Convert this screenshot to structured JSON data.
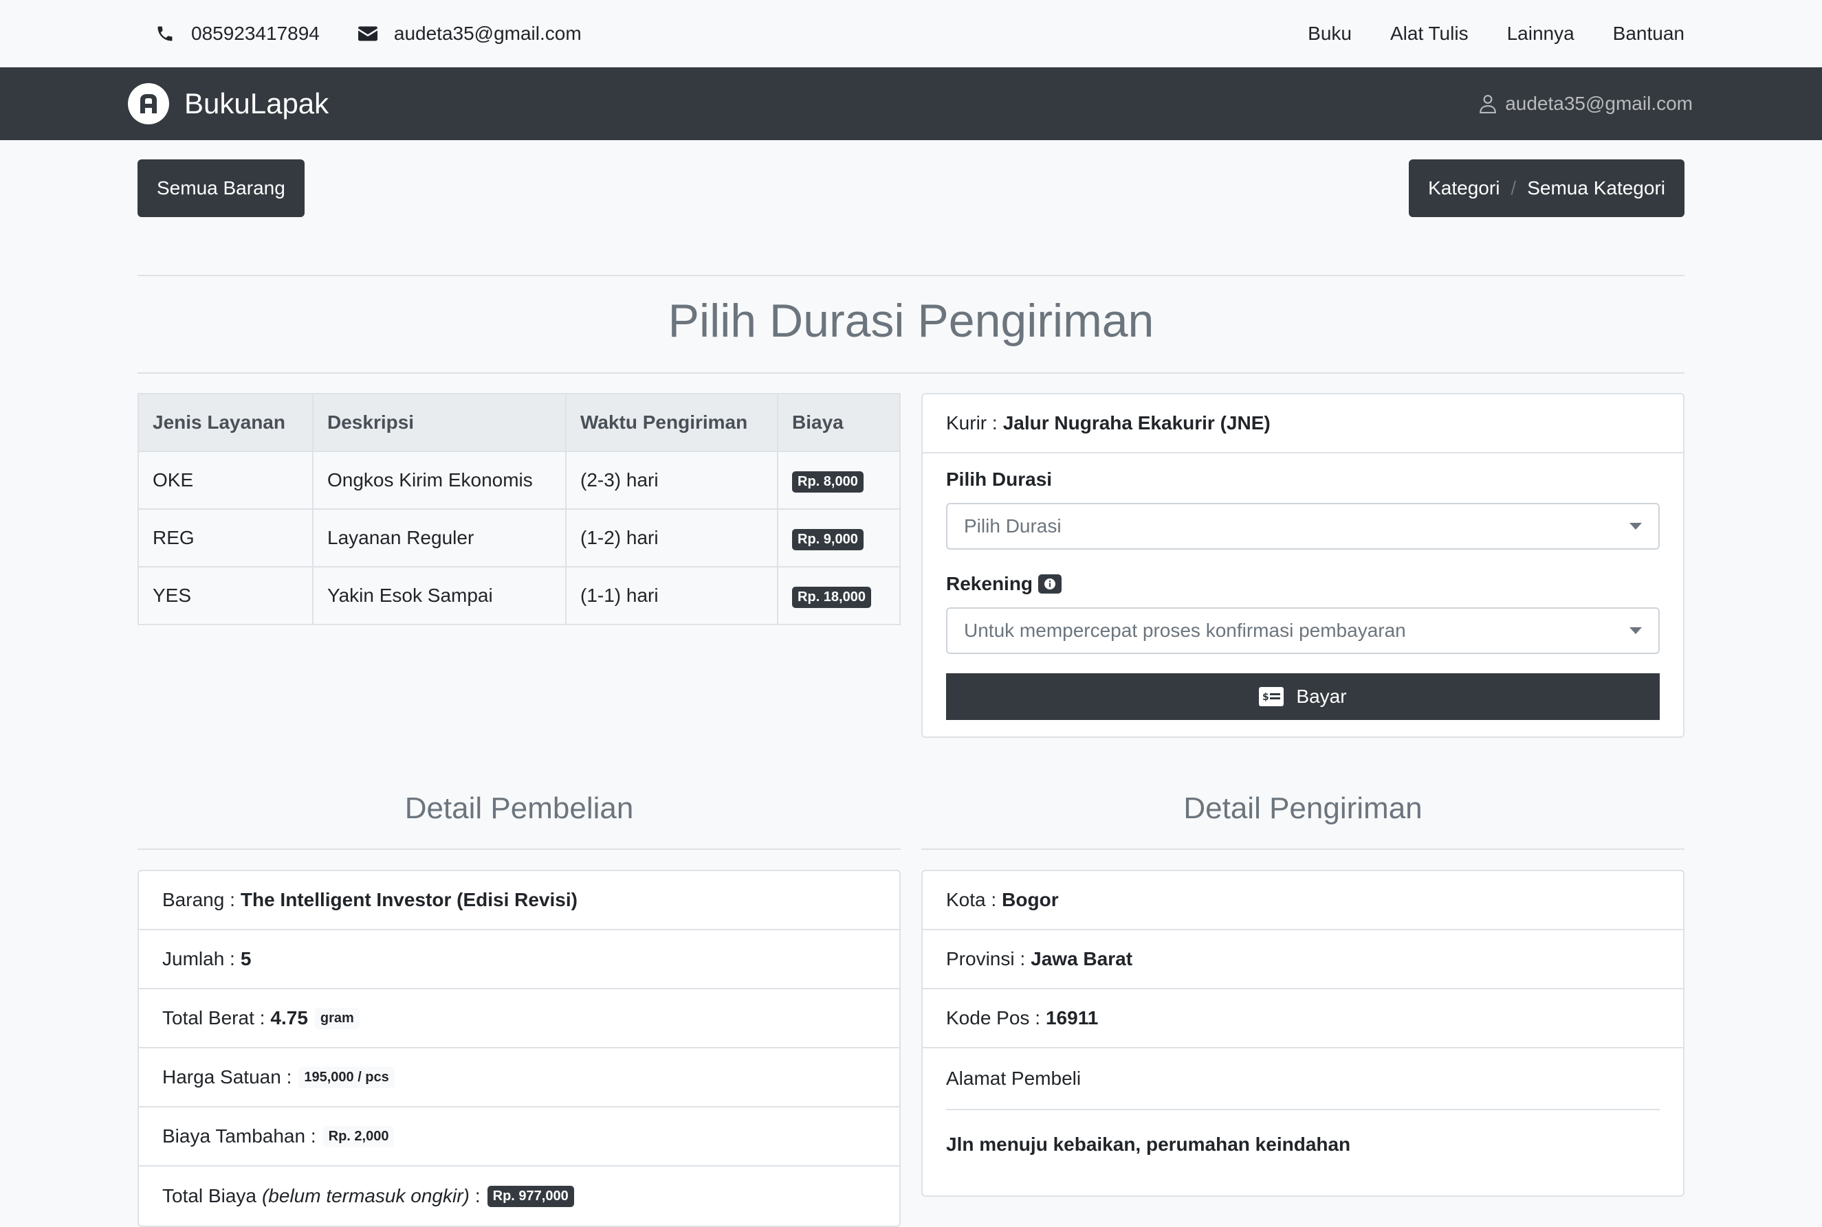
{
  "topbar": {
    "phone": "085923417894",
    "email": "audeta35@gmail.com",
    "links": [
      "Buku",
      "Alat Tulis",
      "Lainnya",
      "Bantuan"
    ]
  },
  "navbar": {
    "brand": "BukuLapak",
    "user_email": "audeta35@gmail.com"
  },
  "actions": {
    "all_items": "Semua Barang",
    "breadcrumb": [
      "Kategori",
      "Semua Kategori"
    ],
    "breadcrumb_sep": "/"
  },
  "page_title": "Pilih Durasi Pengiriman",
  "shipping_table": {
    "headers": [
      "Jenis Layanan",
      "Deskripsi",
      "Waktu Pengiriman",
      "Biaya"
    ],
    "rows": [
      {
        "service": "OKE",
        "desc": "Ongkos Kirim Ekonomis",
        "time": "(2-3) hari",
        "cost": "Rp. 8,000"
      },
      {
        "service": "REG",
        "desc": "Layanan Reguler",
        "time": "(1-2) hari",
        "cost": "Rp. 9,000"
      },
      {
        "service": "YES",
        "desc": "Yakin Esok Sampai",
        "time": "(1-1) hari",
        "cost": "Rp. 18,000"
      }
    ]
  },
  "courier": {
    "label": "Kurir :",
    "value": "Jalur Nugraha Ekakurir (JNE)",
    "duration_label": "Pilih Durasi",
    "duration_placeholder": "Pilih Durasi",
    "account_label": "Rekening",
    "account_placeholder": "Untuk mempercepat proses konfirmasi pembayaran",
    "pay_label": "Bayar"
  },
  "purchase": {
    "title": "Detail Pembelian",
    "item_label": "Barang :",
    "item_value": "The Intelligent Investor (Edisi Revisi)",
    "qty_label": "Jumlah :",
    "qty_value": "5",
    "weight_label": "Total Berat :",
    "weight_value": "4.75",
    "weight_unit": "gram",
    "price_label": "Harga Satuan :",
    "price_value": "195,000 / pcs",
    "extra_label": "Biaya Tambahan :",
    "extra_value": "Rp. 2,000",
    "total_label": "Total Biaya",
    "total_note": "(belum termasuk ongkir)",
    "total_colon": ":",
    "total_value": "Rp. 977,000"
  },
  "shipping": {
    "title": "Detail Pengiriman",
    "city_label": "Kota :",
    "city_value": "Bogor",
    "province_label": "Provinsi :",
    "province_value": "Jawa Barat",
    "zip_label": "Kode Pos :",
    "zip_value": "16911",
    "address_label": "Alamat Pembeli",
    "address_value": "Jln menuju kebaikan, perumahan keindahan"
  }
}
